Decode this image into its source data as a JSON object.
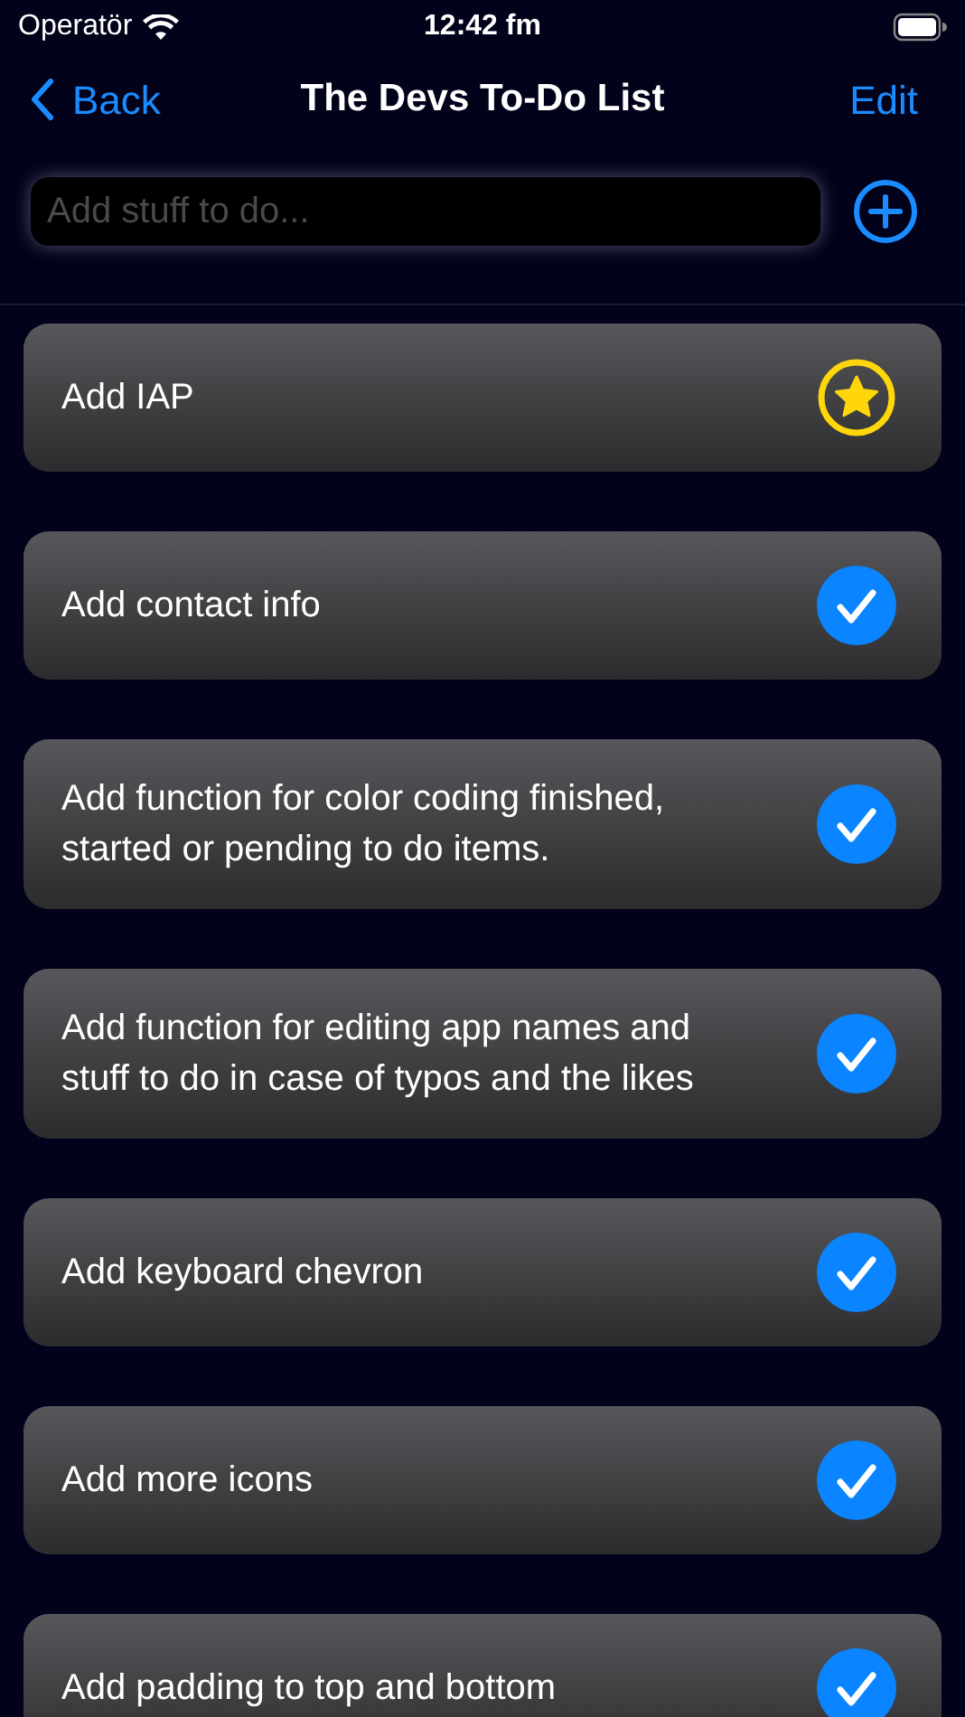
{
  "status_bar": {
    "carrier": "Operatör",
    "time": "12:42 fm"
  },
  "nav": {
    "back": "Back",
    "title": "The Devs To-Do List",
    "edit": "Edit"
  },
  "new_item": {
    "placeholder": "Add stuff to do..."
  },
  "items": [
    {
      "text": "Add IAP",
      "kind": "starred"
    },
    {
      "text": "Add contact info",
      "kind": "done"
    },
    {
      "text": "Add function for color coding finished, started or pending to do items.",
      "kind": "done"
    },
    {
      "text": "Add function for editing app names and stuff to do in case of typos and the likes",
      "kind": "done"
    },
    {
      "text": "Add keyboard chevron",
      "kind": "done"
    },
    {
      "text": "Add more icons",
      "kind": "done"
    },
    {
      "text": "Add padding to top and bottom",
      "kind": "done"
    }
  ]
}
